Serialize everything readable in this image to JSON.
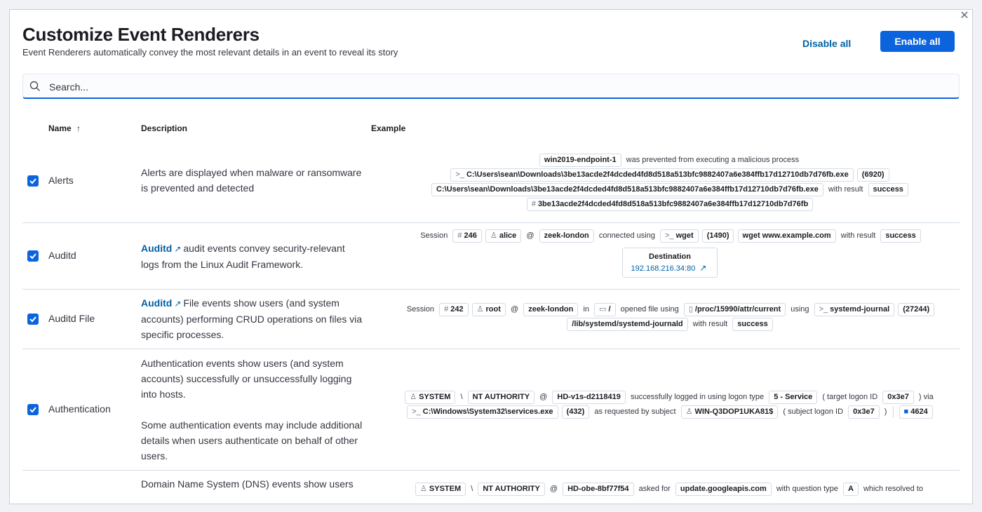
{
  "header": {
    "title": "Customize Event Renderers",
    "subtitle": "Event Renderers automatically convey the most relevant details in an event to reveal its story",
    "disable_all": "Disable all",
    "enable_all": "Enable all",
    "close_icon": "close-icon"
  },
  "search": {
    "placeholder": "Search...",
    "value": ""
  },
  "table": {
    "columns": {
      "name": "Name",
      "sort_icon": "↑",
      "description": "Description",
      "example": "Example"
    },
    "rows": [
      {
        "name": "Alerts",
        "checked": true,
        "description": "Alerts are displayed when malware or ransomware is prevented and detected",
        "example": {
          "host": "win2019-endpoint-1",
          "text1": "was prevented from executing a malicious process",
          "process_path": "C:\\Users\\sean\\Downloads\\3be13acde2f4dcded4fd8d518a513bfc9882407a6e384ffb17d12710db7d76fb.exe",
          "pid": "(6920)",
          "file_path": "C:\\Users\\sean\\Downloads\\3be13acde2f4dcded4fd8d518a513bfc9882407a6e384ffb17d12710db7d76fb.exe",
          "with_result": "with result",
          "result": "success",
          "hash": "3be13acde2f4dcded4fd8d518a513bfc9882407a6e384ffb17d12710db7d76fb"
        }
      },
      {
        "name": "Auditd",
        "checked": true,
        "desc_link": "Auditd",
        "description": "audit events convey security-relevant logs from the Linux Audit Framework.",
        "example": {
          "session": "Session",
          "session_id": "246",
          "user": "alice",
          "at": "@",
          "host": "zeek-london",
          "connected": "connected using",
          "process": "wget",
          "pid": "(1490)",
          "args": "wget www.example.com",
          "with_result": "with result",
          "result": "success",
          "dest_title": "Destination",
          "dest_ip": "192.168.216.34",
          "dest_sep": ":",
          "dest_port": "80"
        }
      },
      {
        "name": "Auditd File",
        "checked": true,
        "desc_link": "Auditd",
        "description": "File events show users (and system accounts) performing CRUD operations on files via specific processes.",
        "example": {
          "session": "Session",
          "session_id": "242",
          "user": "root",
          "at": "@",
          "host": "zeek-london",
          "in": "in",
          "dir": "/",
          "opened": "opened file using",
          "file": "/proc/15990/attr/current",
          "using": "using",
          "process": "systemd-journal",
          "pid": "(27244)",
          "exe": "/lib/systemd/systemd-journald",
          "with_result": "with result",
          "result": "success"
        }
      },
      {
        "name": "Authentication",
        "checked": true,
        "description": "Authentication events show users (and system accounts) successfully or unsuccessfully logging into hosts.",
        "description2": "Some authentication events may include additional details when users authenticate on behalf of other users.",
        "example": {
          "user": "SYSTEM",
          "backslash": "\\",
          "domain": "NT AUTHORITY",
          "at": "@",
          "host": "HD-v1s-d2118419",
          "text1": "successfully logged in using logon type",
          "logon_type": "5 - Service",
          "target_logon": "( target logon ID",
          "logon_id": "0x3e7",
          "via": ") via",
          "process": "C:\\Windows\\System32\\services.exe",
          "pid": "(432)",
          "requested": "as requested by subject",
          "subject": "WIN-Q3DOP1UKA81$",
          "subject_logon": "( subject logon ID",
          "subject_logon_id": "0x3e7",
          "close": ")",
          "event_code": "4624"
        }
      },
      {
        "name": "",
        "checked": false,
        "description": "Domain Name System (DNS) events show users",
        "example": {
          "user": "SYSTEM",
          "backslash": "\\",
          "domain": "NT AUTHORITY",
          "at": "@",
          "host": "HD-obe-8bf77f54",
          "asked": "asked for",
          "query": "update.googleapis.com",
          "qtype_text": "with question type",
          "qtype": "A",
          "resolved": "which resolved to"
        }
      }
    ]
  }
}
